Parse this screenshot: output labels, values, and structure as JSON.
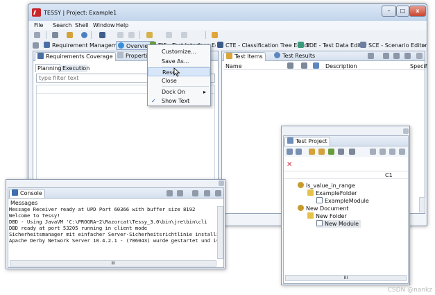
{
  "window": {
    "title": "TESSY | Project: Example1",
    "min": "–",
    "max": "□",
    "close": "x"
  },
  "menubar": [
    "File",
    "Search",
    "Shell",
    "Window",
    "Help"
  ],
  "perspectives": [
    {
      "label": "Requirement Management",
      "color": "#4a6fa5"
    },
    {
      "label": "Overview",
      "color": "#3a8fd6"
    },
    {
      "label": "TIE - Test Interface Editor",
      "color": "#6a9c3c"
    },
    {
      "label": "CTE - Classification Tree Editor",
      "color": "#3b5a87"
    },
    {
      "label": "TDE - Test Data Editor",
      "color": "#3a9b7a"
    },
    {
      "label": "SCE - Scenario Editor",
      "color": "#6c7fa3"
    }
  ],
  "more_chevron": "»",
  "left_panel": {
    "tab_active": "Requirements Coverage",
    "tab_other": "Properties",
    "subtabs": [
      "Planning",
      "Execution"
    ],
    "filter_placeholder": "type filter text"
  },
  "context_menu": {
    "items": [
      "Customize...",
      "Save As...",
      "Reset",
      "Close",
      "Dock On",
      "Show Text"
    ],
    "hovered": "Reset",
    "checked": "Show Text",
    "submenu_arrow": "▸",
    "check_mark": "✓"
  },
  "right_panel": {
    "tab_active": "Test Items",
    "tab_other": "Test Results",
    "col_name": "Name",
    "col_description": "Description",
    "col_spec": "Specif"
  },
  "console": {
    "tab": "Console",
    "section": "Messages",
    "lines": [
      "Message Receiver ready at UPD Port 60366 with buffer size 8192",
      "Welcome to Tessy!",
      "DBD - Using JavaVM 'C:\\PROGRA~2\\Razorcat\\Tessy_3.0\\bin\\jre\\bin\\cli",
      "DBD ready at port 53205 running in client mode",
      "Sicherheitsmanager mit einfacher Server-Sicherheitsrichtlinie installi",
      "Apache Derby Network Server 10.4.2.1 - (706043) wurde gestartet und is"
    ],
    "scroll_mark": "III"
  },
  "project": {
    "tab": "Test Project",
    "col_c1": "C1",
    "tree": [
      {
        "label": "Is_value_in_range",
        "level": 0,
        "kind": "module"
      },
      {
        "label": "ExampleFolder",
        "level": 1,
        "kind": "folder"
      },
      {
        "label": "ExampleModule",
        "level": 2,
        "kind": "file"
      },
      {
        "label": "New Document",
        "level": 0,
        "kind": "module"
      },
      {
        "label": "New Folder",
        "level": 1,
        "kind": "folder"
      },
      {
        "label": "New Module",
        "level": 2,
        "kind": "file"
      }
    ],
    "selected": "New Module",
    "scroll_mark": "III"
  },
  "watermark": "CSDN @nankz"
}
